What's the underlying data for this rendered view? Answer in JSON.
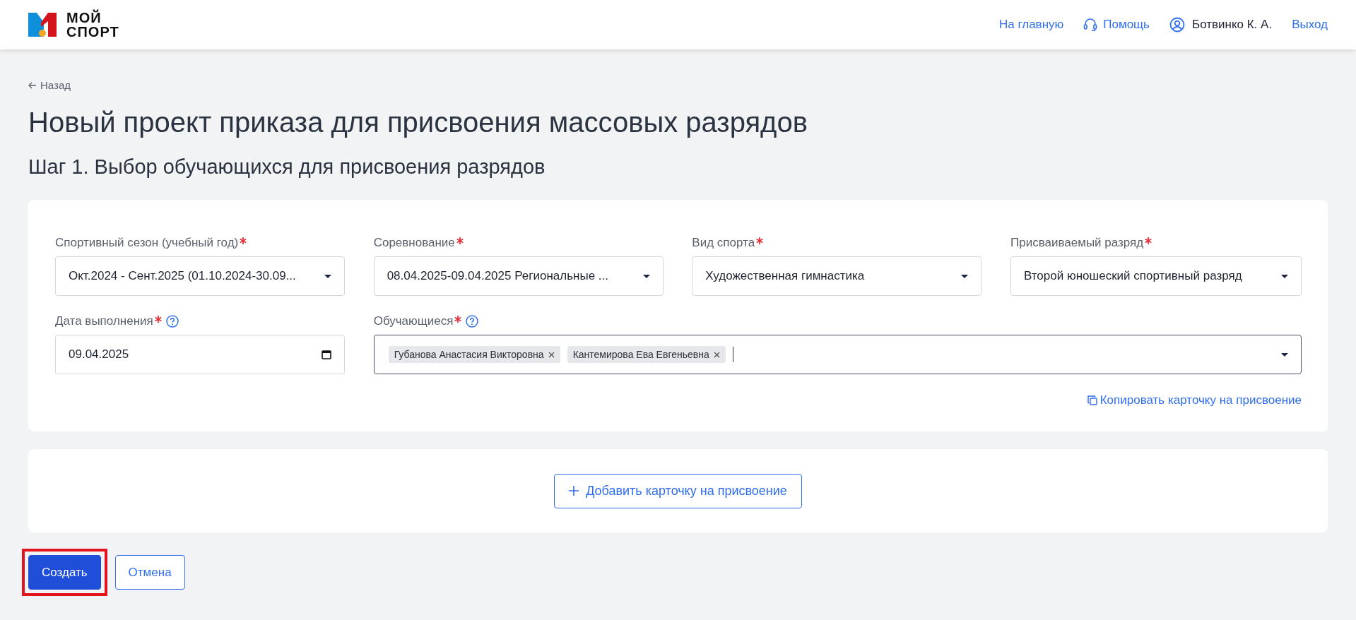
{
  "header": {
    "logo": {
      "line_1": "МОЙ",
      "line_2": "СПОРТ"
    },
    "nav": [
      {
        "kind": "link",
        "label": "На главную"
      },
      {
        "kind": "help",
        "label": "Помощь"
      },
      {
        "kind": "user",
        "label": "Ботвинко К. А."
      },
      {
        "kind": "link",
        "label": "Выход"
      }
    ]
  },
  "back_link": "Назад",
  "title": "Новый проект приказа для присвоения массовых разрядов",
  "subtitle": "Шаг 1. Выбор обучающихся для присвоения разрядов",
  "fields": [
    {
      "kind": "select",
      "label": "Спортивный сезон (учебный год)",
      "required": true,
      "help": false,
      "value": "Окт.2024 - Сент.2025 (01.10.2024-30.09..."
    },
    {
      "kind": "select",
      "label": "Соревнование",
      "required": true,
      "help": false,
      "value": "08.04.2025-09.04.2025 Региональные ..."
    },
    {
      "kind": "select",
      "label": "Вид спорта",
      "required": true,
      "help": false,
      "value": "Художественная гимнастика"
    },
    {
      "kind": "select",
      "label": "Присваиваемый разряд",
      "required": true,
      "help": false,
      "value": "Второй юношеский спортивный разряд"
    },
    {
      "kind": "date",
      "label": "Дата выполнения",
      "required": true,
      "help": true,
      "value": "09.04.2025"
    },
    {
      "kind": "tags",
      "label": "Обучающиеся",
      "required": true,
      "help": true,
      "tags": [
        "Губанова Анастасия Викторовна",
        "Кантемирова Ева Евгеньевна"
      ]
    }
  ],
  "copy_link": "Копировать карточку на присвоение",
  "add_card_button": "Добавить карточку на присвоение",
  "actions": [
    {
      "kind": "primary",
      "label": "Создать",
      "highlighted": true
    },
    {
      "kind": "secondary",
      "label": "Отмена",
      "highlighted": false
    }
  ]
}
